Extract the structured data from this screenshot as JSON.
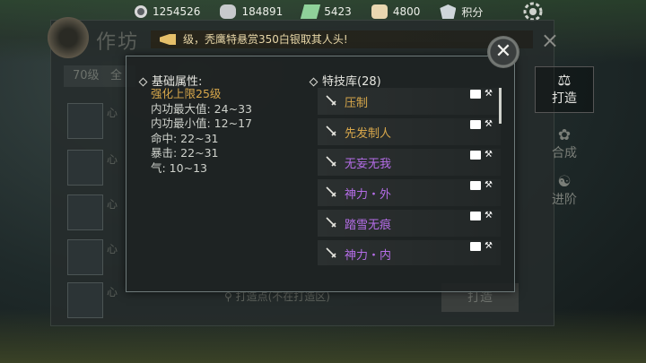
{
  "resources": [
    {
      "name": "reel-icon",
      "value": "1254526"
    },
    {
      "name": "silver-icon",
      "value": "184891"
    },
    {
      "name": "ticket-icon",
      "value": "5423"
    },
    {
      "name": "bag-icon",
      "value": "4800"
    },
    {
      "name": "shield-icon",
      "value": "积分"
    }
  ],
  "forge": {
    "title": "作坊",
    "level_filter": "70级",
    "filter_all": "全",
    "recipe_prefix": "心",
    "search_placeholder": "打造点(不在打造区)",
    "forge_button": "打造",
    "close": "×"
  },
  "side_tabs": [
    {
      "label": "打造",
      "active": true
    },
    {
      "label": "合成",
      "active": false
    },
    {
      "label": "进阶",
      "active": false
    }
  ],
  "announcement": "级，秃鹰特悬赏350白银取其人头!",
  "popup": {
    "close": "✕",
    "attr_title": "基础属性:",
    "attrs": [
      {
        "text": "强化上限25级",
        "highlight": true
      },
      {
        "text": "内功最大值: 24~33",
        "highlight": false
      },
      {
        "text": "内功最小值: 12~17",
        "highlight": false
      },
      {
        "text": "命中: 22~31",
        "highlight": false
      },
      {
        "text": "暴击: 22~31",
        "highlight": false
      },
      {
        "text": "气: 10~13",
        "highlight": false
      }
    ],
    "skill_title": "特技库(28)",
    "skills": [
      {
        "name": "压制",
        "color": "#d7a74b"
      },
      {
        "name": "先发制人",
        "color": "#d7a74b"
      },
      {
        "name": "无妄无我",
        "color": "#b56de8"
      },
      {
        "name": "神力・外",
        "color": "#b56de8"
      },
      {
        "name": "踏雪无痕",
        "color": "#b56de8"
      },
      {
        "name": "神力・内",
        "color": "#b56de8"
      }
    ]
  },
  "colors": {
    "gold": "#d7a74b",
    "purple": "#b56de8"
  }
}
